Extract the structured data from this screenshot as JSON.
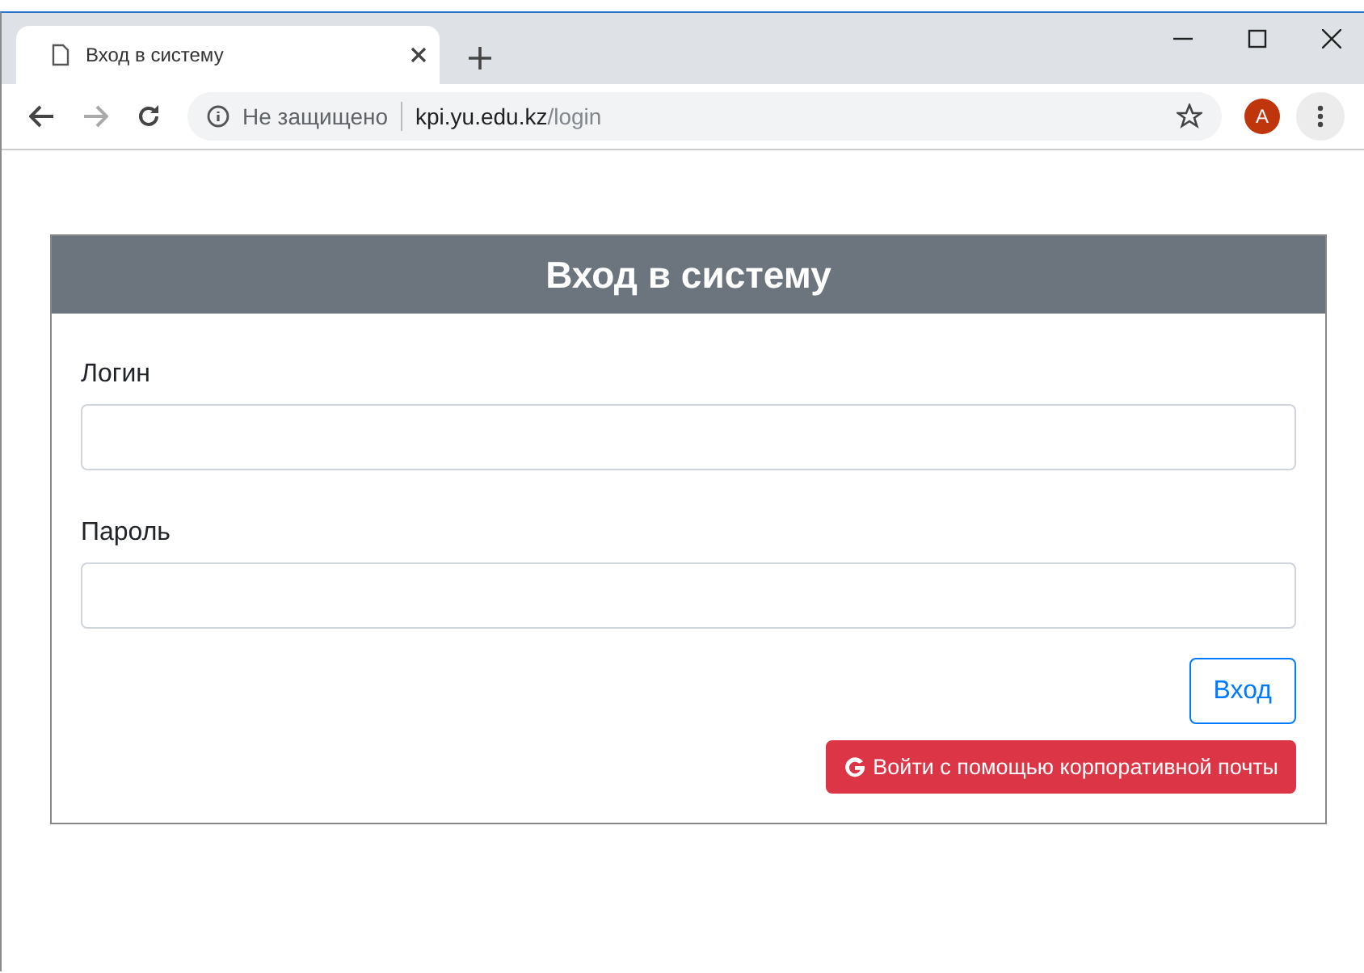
{
  "browser": {
    "tab": {
      "title": "Вход в систему",
      "selected": true
    },
    "security": "Не защищено",
    "url_host": "kpi.yu.edu.kz",
    "url_path": "/login",
    "avatar": "A"
  },
  "card": {
    "title": "Вход в систему",
    "fields": [
      {
        "label": "Логин"
      },
      {
        "label": "Пароль"
      }
    ],
    "buttons": [
      {
        "label": "Вход",
        "kind": "outline"
      },
      {
        "label": "Войти с помощью корпоративной почты",
        "kind": "google"
      }
    ]
  }
}
